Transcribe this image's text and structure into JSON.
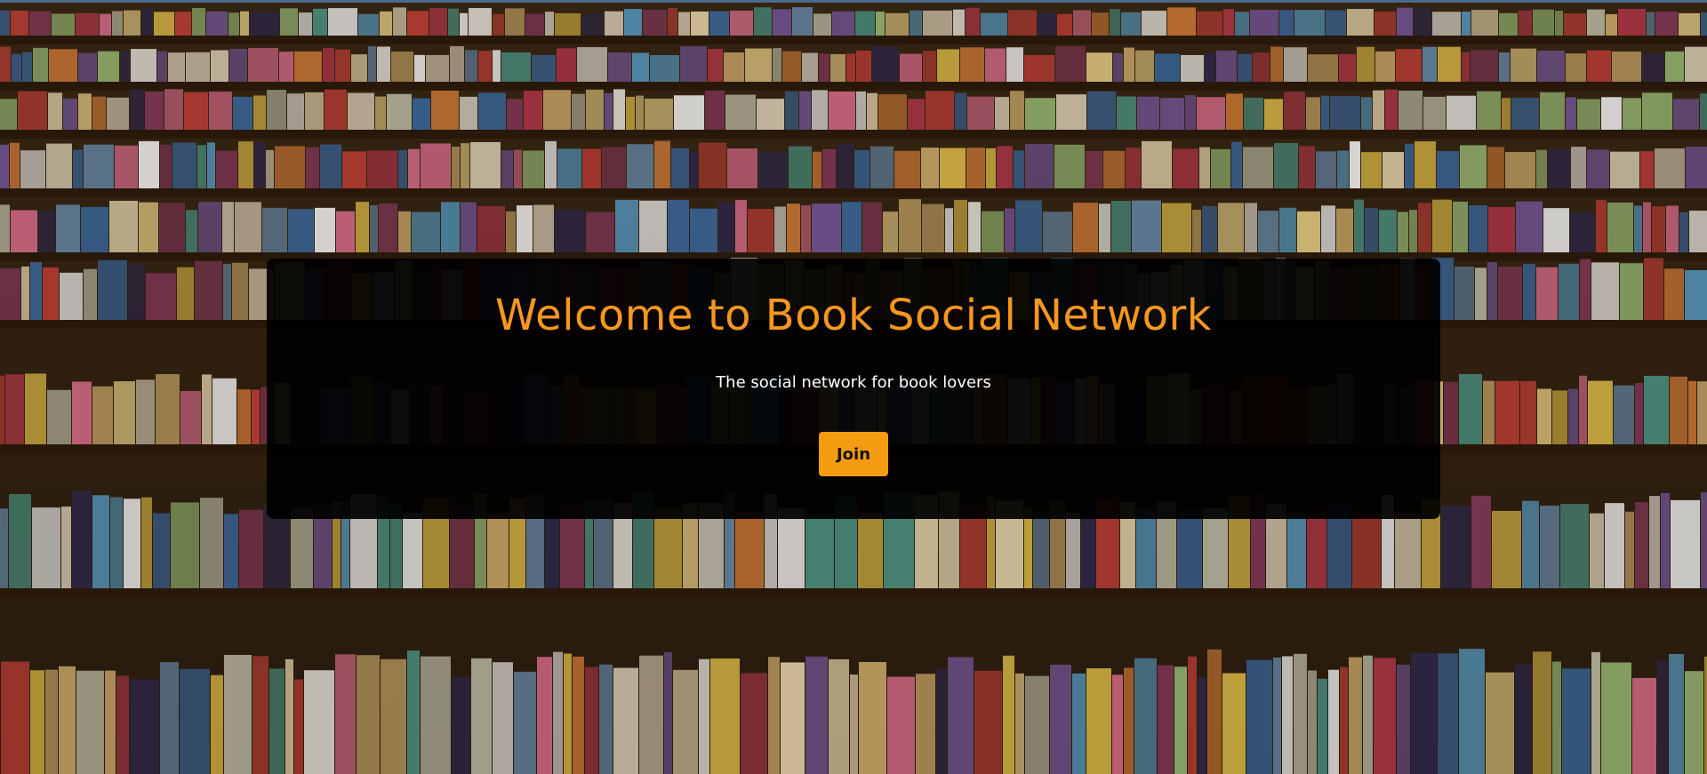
{
  "hero": {
    "title": "Welcome to Book Social Network",
    "subtitle": "The social network for book lovers",
    "join_label": "Join"
  },
  "colors": {
    "accent": "#f7971e",
    "button_bg": "#f59b12",
    "panel_bg": "#000000",
    "subtitle_text": "#ffffff"
  },
  "background": {
    "image": "bookshelf-photo"
  }
}
